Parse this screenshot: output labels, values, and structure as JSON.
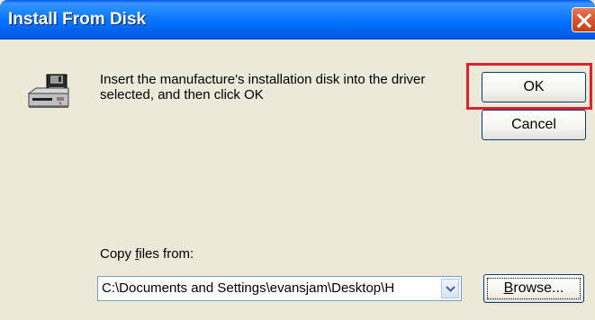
{
  "window": {
    "title": "Install From Disk"
  },
  "message": {
    "line1": "Insert the manufacture's installation disk into the driver",
    "line2": "selected, and then click OK"
  },
  "buttons": {
    "ok_label": "OK",
    "cancel_label": "Cancel",
    "browse_label": "Browse..."
  },
  "copy_from": {
    "label_before": "Copy ",
    "label_accel": "f",
    "label_after": "iles from:",
    "value": "C:\\Documents and Settings\\evansjam\\Desktop\\H"
  },
  "icons": {
    "close": "close-icon",
    "disk": "disk-drive-icon",
    "dropdown": "chevron-down-icon"
  },
  "colors": {
    "highlight": "#e0202a",
    "titlebar": "#0058ee",
    "close_button": "#d45a33"
  }
}
